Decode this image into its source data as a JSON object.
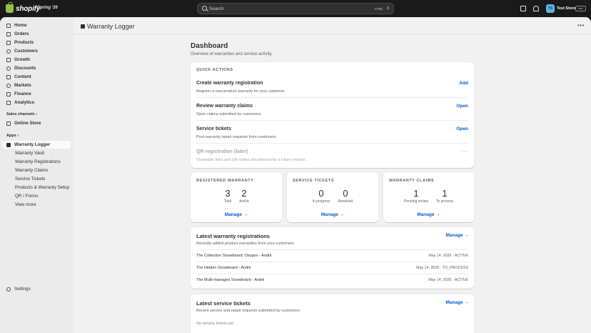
{
  "topbar": {
    "logo_text": "shopify",
    "edition": "Spring '26",
    "search_placeholder": "Search",
    "search_kbd": "CTRL",
    "search_kbd2": "K",
    "avatar_initials": "TS",
    "store_name": "Test Store",
    "dev_badge": "dev"
  },
  "sidebar": {
    "items": [
      {
        "label": "Home",
        "icon": "home-icon"
      },
      {
        "label": "Orders",
        "icon": "orders-icon"
      },
      {
        "label": "Products",
        "icon": "tag-icon"
      },
      {
        "label": "Customers",
        "icon": "person-icon"
      },
      {
        "label": "Growth",
        "icon": "growth-icon"
      },
      {
        "label": "Discounts",
        "icon": "discount-icon"
      },
      {
        "label": "Content",
        "icon": "content-icon"
      },
      {
        "label": "Markets",
        "icon": "globe-icon"
      },
      {
        "label": "Finance",
        "icon": "bank-icon"
      },
      {
        "label": "Analytics",
        "icon": "chart-icon"
      }
    ],
    "sales_channels_heading": "Sales channels",
    "online_store": "Online Store",
    "apps_heading": "Apps",
    "app_name": "Warranty Logger",
    "app_subitems": [
      "Warranty Vault",
      "Warranty Registrations",
      "Warranty Claims",
      "Service Tickets",
      "Products & Warranty Setup",
      "QR / Forms",
      "View more"
    ],
    "settings": "Settings"
  },
  "app_header": {
    "title": "Warranty Logger",
    "more": "•••"
  },
  "dashboard": {
    "title": "Dashboard",
    "subtitle": "Overview of warranties and service activity."
  },
  "quick_actions": {
    "label": "QUICK ACTIONS",
    "rows": [
      {
        "title": "Create warranty registration",
        "desc": "Register a new product warranty for your customer.",
        "action": "Add"
      },
      {
        "title": "Review warranty claims",
        "desc": "Open claims submitted by customers.",
        "action": "Open"
      },
      {
        "title": "Service tickets",
        "desc": "Post-warranty repair requests from customers.",
        "action": "Open"
      },
      {
        "title": "QR registration (later)",
        "desc": "Shareable links and QR codes are planned for a future release.",
        "action": "···"
      }
    ]
  },
  "stats": [
    {
      "label": "REGISTERED WARRANTY",
      "a_num": "3",
      "a_lbl": "Total",
      "b_num": "2",
      "b_lbl": "Active",
      "link": "Manage →"
    },
    {
      "label": "SERVICE TICKETS",
      "a_num": "0",
      "a_lbl": "In progress",
      "b_num": "0",
      "b_lbl": "Resolved",
      "link": "Manage →"
    },
    {
      "label": "WARRANTY CLAIMS",
      "a_num": "1",
      "a_lbl": "Pending review",
      "b_num": "1",
      "b_lbl": "To process",
      "link": "Manage →"
    }
  ],
  "latest_registrations": {
    "title": "Latest warranty registrations",
    "subtitle": "Recently added product warranties from your customers.",
    "manage": "Manage →",
    "rows": [
      {
        "name": "The Collection Snowboard: Oxygen - Andrii",
        "meta": "May 14, 2026 · ACTIVE"
      },
      {
        "name": "The Hidden Snowboard - Andrii",
        "meta": "May 14, 2026 · TO_PROCESS"
      },
      {
        "name": "The Multi-managed Snowboard - Andrii",
        "meta": "May 14, 2026 · ACTIVE"
      }
    ]
  },
  "latest_tickets": {
    "title": "Latest service tickets",
    "subtitle": "Recent service and repair requests submitted by customers.",
    "manage": "Manage →",
    "empty": "No service tickets yet."
  },
  "colors": {
    "link": "#005bd3",
    "topbar": "#1a1a1a",
    "brand_green": "#95bf47"
  }
}
